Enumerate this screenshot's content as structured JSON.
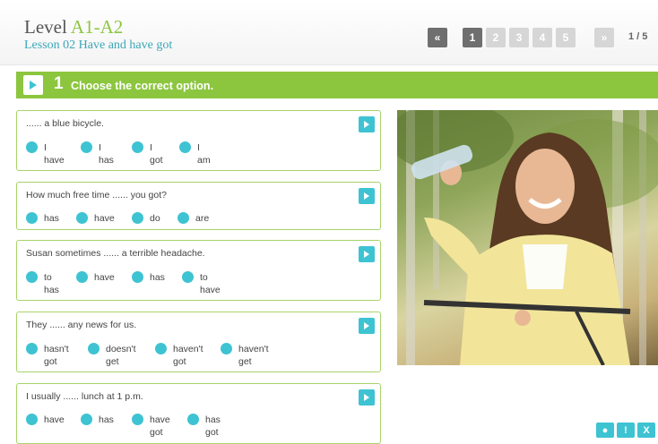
{
  "header": {
    "level_prefix": "Level ",
    "level_code": "A1-A2",
    "lesson": "Lesson 02 Have and have got"
  },
  "pagination": {
    "prev": "«",
    "pages": [
      "1",
      "2",
      "3",
      "4",
      "5"
    ],
    "next": "»",
    "count": "1 / 5"
  },
  "exercise": {
    "number": "1",
    "instruction": "Choose the correct option."
  },
  "questions": [
    {
      "text": "...... a blue bicycle.",
      "options": [
        "I\nhave",
        "I\nhas",
        "I\ngot",
        "I\nam"
      ]
    },
    {
      "text": "How much free time ...... you got?",
      "options": [
        "has",
        "have",
        "do",
        "are"
      ]
    },
    {
      "text": "Susan sometimes ...... a terrible headache.",
      "options": [
        "to\nhas",
        "have",
        "has",
        "to\nhave"
      ]
    },
    {
      "text": "They ...... any news for us.",
      "options": [
        "hasn't\ngot",
        "doesn't\nget",
        "haven't\ngot",
        "haven't\nget"
      ]
    },
    {
      "text": "I usually ...... lunch at 1 p.m.",
      "options": [
        "have",
        "has",
        "have\ngot",
        "has\ngot"
      ]
    }
  ],
  "tools": [
    "●",
    "!",
    "X"
  ],
  "colors": {
    "green": "#8cc63f",
    "teal": "#3ec3d2",
    "gray": "#6f6f6f"
  }
}
